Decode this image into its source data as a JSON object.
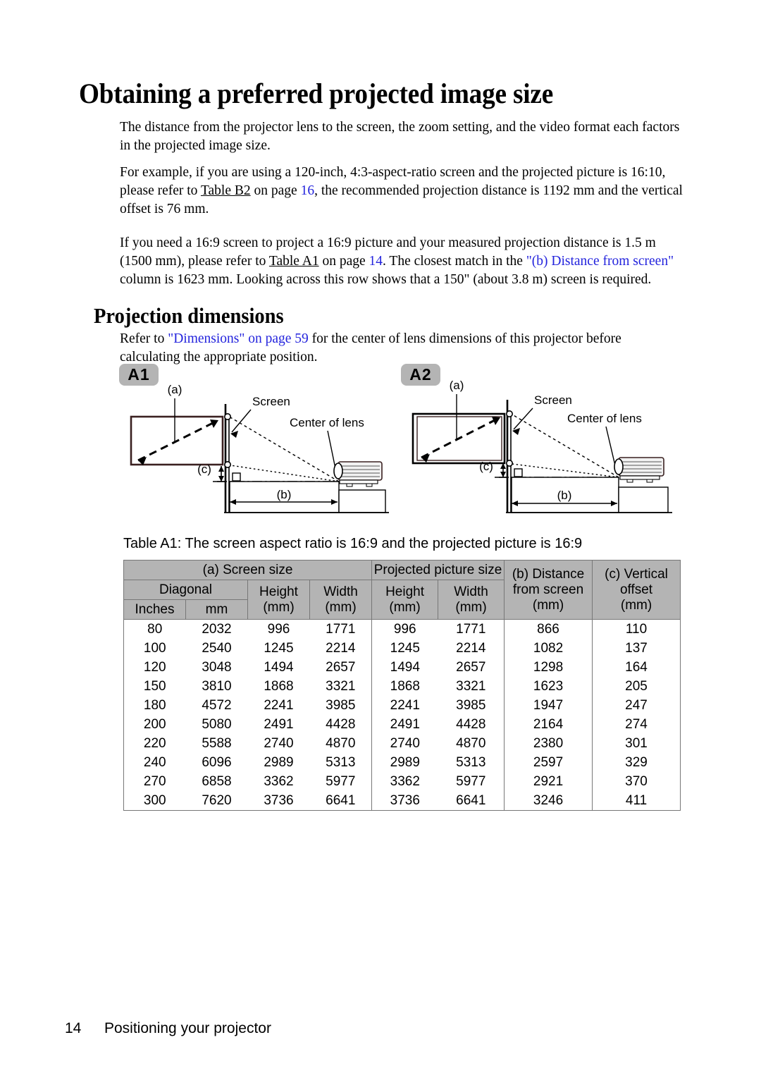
{
  "document": {
    "heading_main": "Obtaining a preferred projected image size",
    "heading_sub": "Projection dimensions"
  },
  "paragraphs": {
    "p1": "The distance from the projector lens to the screen, the zoom setting, and the video format each factors in the projected image size.",
    "p2_a": "For example, if you are using a 120-inch, 4:3-aspect-ratio screen and the projected picture is 16:10, please refer to ",
    "p2_link_table": "Table B2",
    "p2_b": " on page ",
    "p2_link_page": "16",
    "p2_c": ", the recommended projection distance is 1192 mm and the vertical offset is 76 mm.",
    "p3_a": "If you need a 16:9 screen to project a 16:9 picture and your measured projection distance is 1.5 m (1500 mm), please refer to ",
    "p3_link_table": "Table A1",
    "p3_b": " on page ",
    "p3_link_page": "14",
    "p3_c": ". The closest match in the ",
    "p3_link_column": "\"(b) Distance from screen\"",
    "p3_d": " column is 1623 mm. Looking across this row shows that a 150\" (about 3.8 m) screen is required.",
    "p4_a": "Refer to ",
    "p4_link": "\"Dimensions\" on page 59",
    "p4_b": " for the center of lens dimensions of this projector before calculating the appropriate position."
  },
  "diagrams": [
    {
      "badge": "A1",
      "label_a": "(a)",
      "label_b": "(b)",
      "label_c": "(c)",
      "label_screen": "Screen",
      "label_lens": "Center of lens"
    },
    {
      "badge": "A2",
      "label_a": "(a)",
      "label_b": "(b)",
      "label_c": "(c)",
      "label_screen": "Screen",
      "label_lens": "Center of lens"
    }
  ],
  "table": {
    "caption": "Table A1: The screen aspect ratio is 16:9 and the projected picture is 16:9",
    "group_headers": {
      "screen_size": "(a) Screen size",
      "projected_picture_size": "Projected picture size",
      "distance": "(b) Distance from screen (mm)",
      "distance_l1": "(b) Distance",
      "distance_l2": "from screen",
      "distance_l3": "(mm)",
      "vertical_offset": "(c) Vertical offset (mm)",
      "vertical_l1": "(c) Vertical",
      "vertical_l2": "offset",
      "vertical_l3": "(mm)"
    },
    "sub_headers": {
      "diagonal": "Diagonal",
      "height_a": "Height",
      "width_a": "Width",
      "height_p": "Height",
      "width_p": "Width"
    },
    "unit_headers": {
      "inches": "Inches",
      "mm": "mm",
      "height_a_mm": "(mm)",
      "width_a_mm": "(mm)",
      "height_p_mm": "(mm)",
      "width_p_mm": "(mm)"
    },
    "columns": [
      "Diagonal Inches",
      "Diagonal mm",
      "Screen Height (mm)",
      "Screen Width (mm)",
      "Picture Height (mm)",
      "Picture Width (mm)",
      "Distance from screen (mm)",
      "Vertical offset (mm)"
    ],
    "rows": [
      [
        "80",
        "2032",
        "996",
        "1771",
        "996",
        "1771",
        "866",
        "110"
      ],
      [
        "100",
        "2540",
        "1245",
        "2214",
        "1245",
        "2214",
        "1082",
        "137"
      ],
      [
        "120",
        "3048",
        "1494",
        "2657",
        "1494",
        "2657",
        "1298",
        "164"
      ],
      [
        "150",
        "3810",
        "1868",
        "3321",
        "1868",
        "3321",
        "1623",
        "205"
      ],
      [
        "180",
        "4572",
        "2241",
        "3985",
        "2241",
        "3985",
        "1947",
        "247"
      ],
      [
        "200",
        "5080",
        "2491",
        "4428",
        "2491",
        "4428",
        "2164",
        "274"
      ],
      [
        "220",
        "5588",
        "2740",
        "4870",
        "2740",
        "4870",
        "2380",
        "301"
      ],
      [
        "240",
        "6096",
        "2989",
        "5313",
        "2989",
        "5313",
        "2597",
        "329"
      ],
      [
        "270",
        "6858",
        "3362",
        "5977",
        "3362",
        "5977",
        "2921",
        "370"
      ],
      [
        "300",
        "7620",
        "3736",
        "6641",
        "3736",
        "6641",
        "3246",
        "411"
      ]
    ]
  },
  "footer": {
    "page_number": "14",
    "section": "Positioning your projector"
  },
  "colors": {
    "link": "#2323dd",
    "header_gray": "#b4b4b4",
    "text": "#000000"
  }
}
